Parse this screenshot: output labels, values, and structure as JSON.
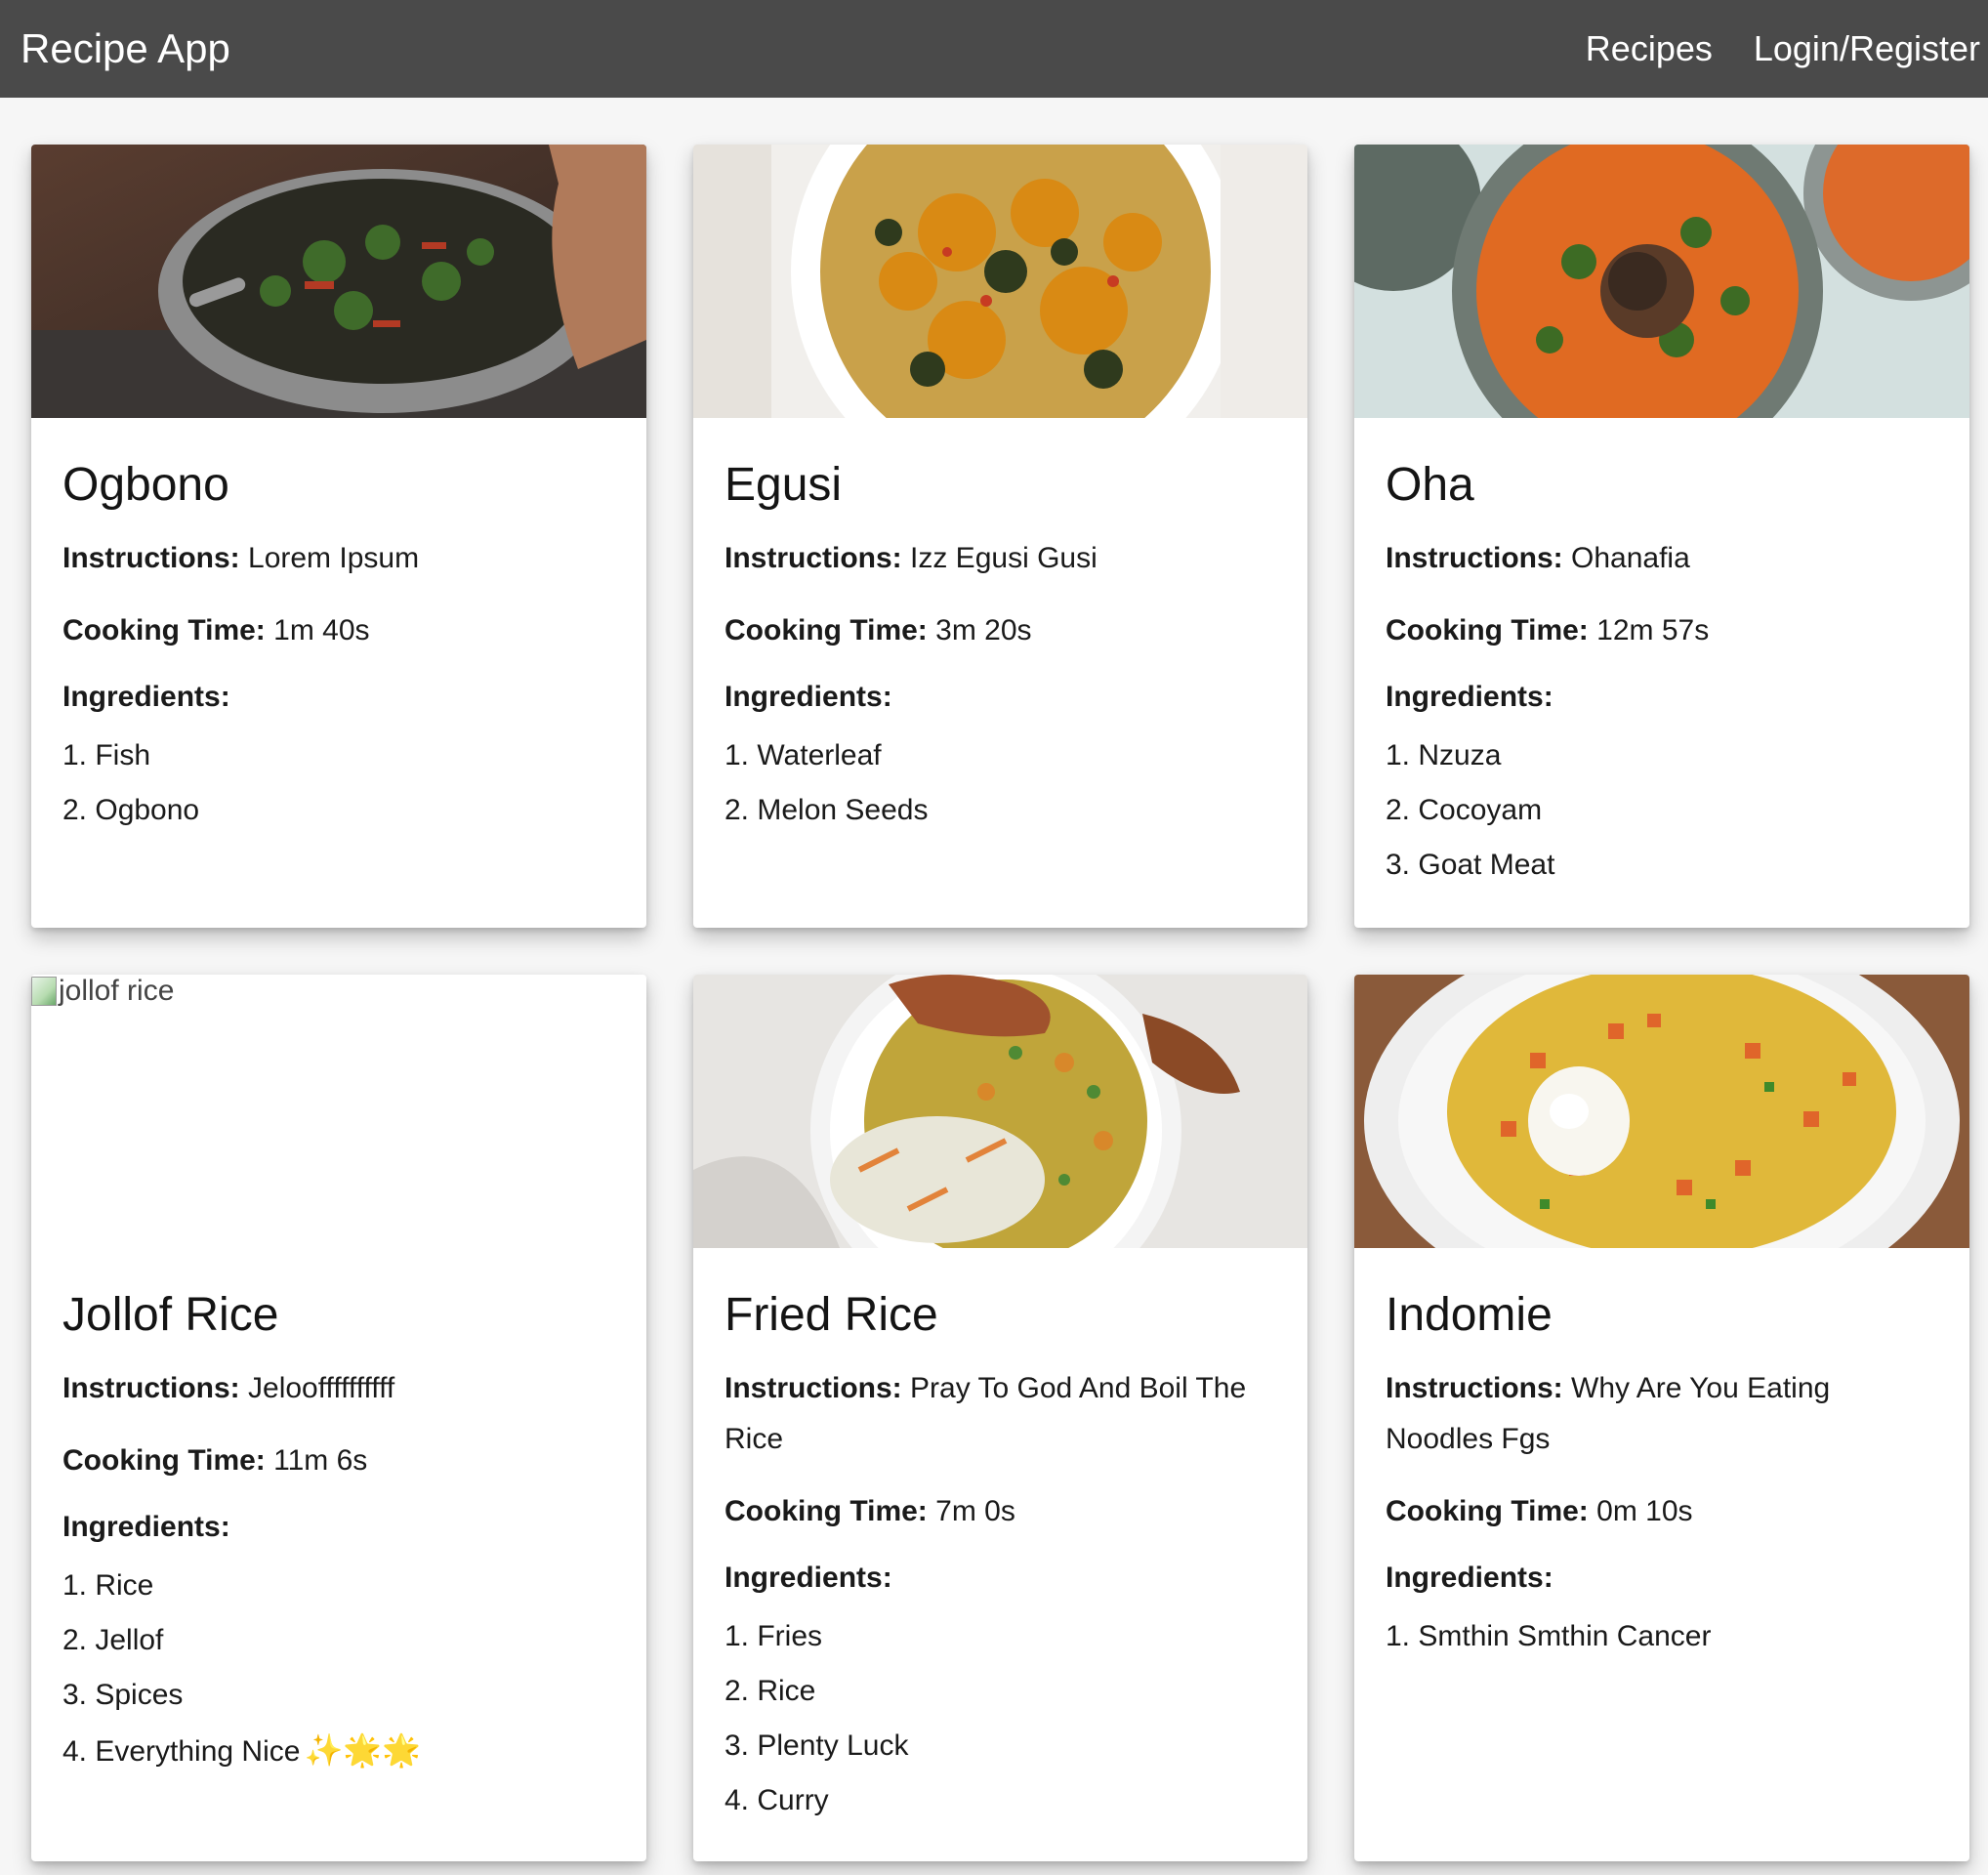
{
  "navbar": {
    "brand": "Recipe App",
    "links": [
      "Recipes",
      "Login/Register"
    ]
  },
  "labels": {
    "instructions": "Instructions:",
    "cooking_time": "Cooking Time:",
    "ingredients": "Ingredients:"
  },
  "recipes": [
    {
      "title": "Ogbono",
      "image": "photo of vegetables frying in a pan",
      "instructions": "Lorem Ipsum",
      "cooking_time": "1m 40s",
      "ingredients": [
        "1. Fish",
        "2. Ogbono"
      ]
    },
    {
      "title": "Egusi",
      "image": "photo of egusi soup in a bowl",
      "instructions": "Izz Egusi Gusi",
      "cooking_time": "3m 20s",
      "ingredients": [
        "1. Waterleaf",
        "2. Melon Seeds"
      ]
    },
    {
      "title": "Oha",
      "image": "photo of oha soup in a bowl",
      "instructions": "Ohanafia",
      "cooking_time": "12m 57s",
      "ingredients": [
        "1. Nzuza",
        "2. Cocoyam",
        "3. Goat Meat"
      ]
    },
    {
      "title": "Jollof Rice",
      "image_alt": "jollof rice",
      "instructions": "Jelooffffffffff",
      "cooking_time": "11m 6s",
      "ingredients": [
        "1. Rice",
        "2. Jellof",
        "3. Spices",
        "4. Everything Nice"
      ],
      "ingredient_suffix": "✨🌟🌟"
    },
    {
      "title": "Fried Rice",
      "image": "photo of fried rice with chicken and coleslaw",
      "instructions": "Pray To God And Boil The Rice",
      "cooking_time": "7m 0s",
      "ingredients": [
        "1. Fries",
        "2. Rice",
        "3. Plenty Luck",
        "4. Curry"
      ]
    },
    {
      "title": "Indomie",
      "image": "photo of noodles with egg and carrots",
      "instructions": "Why Are You Eating Noodles Fgs",
      "cooking_time": "0m 10s",
      "ingredients": [
        "1. Smthin Smthin Cancer"
      ]
    }
  ]
}
